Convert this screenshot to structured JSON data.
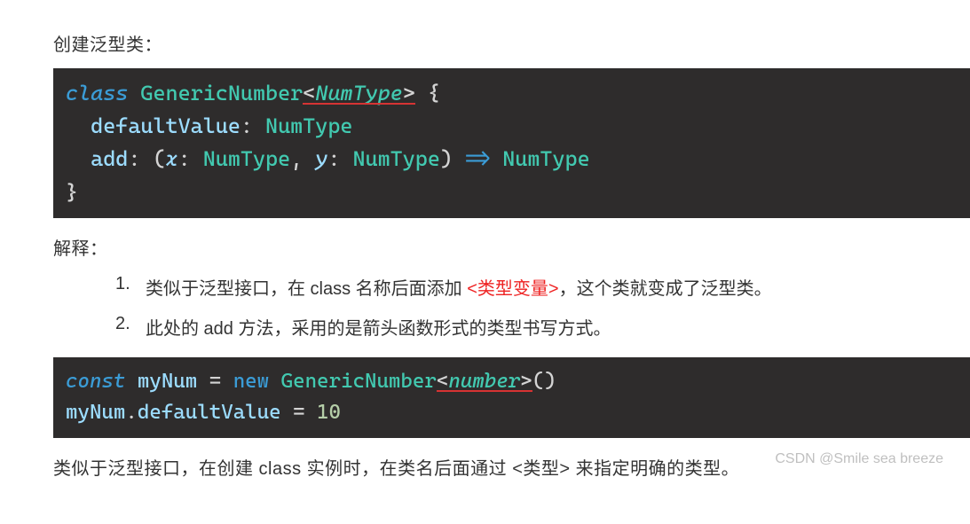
{
  "heading1": "创建泛型类：",
  "code1": {
    "kw_class": "class",
    "space": " ",
    "cls_name": "GenericNumber",
    "lt": "<",
    "generic": "NumType",
    "gt": ">",
    "brace_open": " {",
    "line2_indent": "  ",
    "prop_default": "defaultValue",
    "colon": ": ",
    "type_num": "NumType",
    "line3_indent": "  ",
    "prop_add": "add",
    "paren_open": "(",
    "param_x": "x",
    "param_y": "y",
    "comma": ", ",
    "paren_close": ")",
    "arrow": " => ",
    "brace_close": "}"
  },
  "heading2": "解释：",
  "list": {
    "num1": "1.",
    "item1_pre": "类似于泛型接口，在 class 名称后面添加 ",
    "item1_red": "<类型变量>",
    "item1_post": "，这个类就变成了泛型类。",
    "num2": "2.",
    "item2": "此处的 add 方法，采用的是箭头函数形式的类型书写方式。"
  },
  "code2": {
    "kw_const": "const",
    "var_mynum": "myNum",
    "eq": " = ",
    "kw_new": "new",
    "cls_name": "GenericNumber",
    "lt": "<",
    "type_number": "number",
    "gt": ">",
    "call": "()",
    "line2_obj": "myNum",
    "dot": ".",
    "prop": "defaultValue",
    "val": "10"
  },
  "footer": "类似于泛型接口，在创建 class 实例时，在类名后面通过 <类型> 来指定明确的类型。",
  "watermark": "CSDN @Smile sea breeze"
}
